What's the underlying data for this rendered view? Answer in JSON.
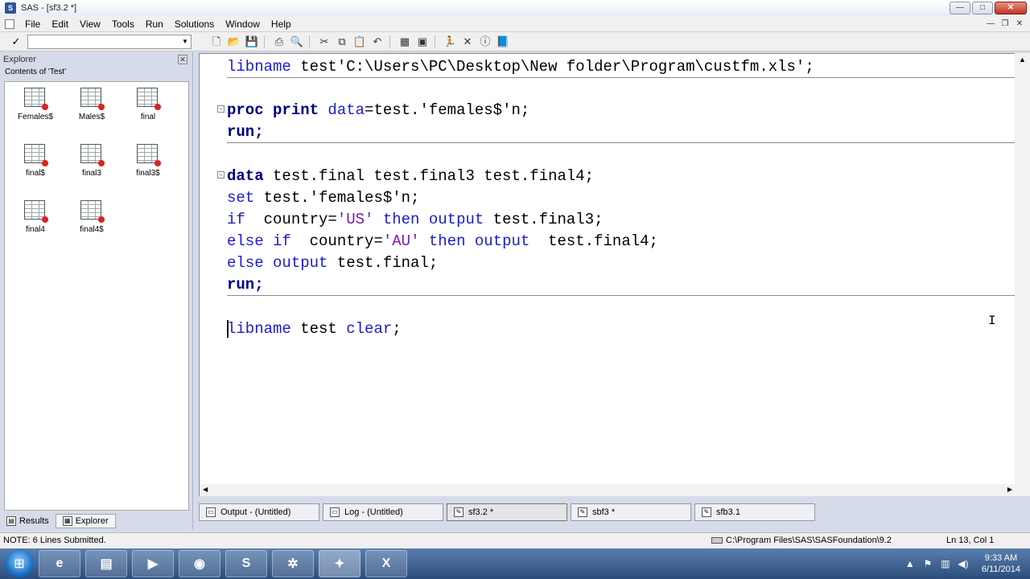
{
  "window": {
    "title": "SAS - [sf3.2 *]",
    "minimize": "—",
    "maximize": "□",
    "close": "✕"
  },
  "menu": [
    "File",
    "Edit",
    "View",
    "Tools",
    "Run",
    "Solutions",
    "Window",
    "Help"
  ],
  "toolbar": {
    "command_check": "✓",
    "command_value": ""
  },
  "explorer": {
    "title": "Explorer",
    "subtitle": "Contents of 'Test'",
    "items": [
      "Females$",
      "Males$",
      "final",
      "final$",
      "final3",
      "final3$",
      "final4",
      "final4$"
    ],
    "tabs": [
      "Results",
      "Explorer"
    ]
  },
  "editor": {
    "lines": {
      "l1a": "libname",
      "l1b": " test'C:\\Users\\PC\\Desktop\\New folder\\Program\\custfm.xls';",
      "l2a": "proc print",
      "l2b": " data",
      "l2c": "=test.'females$'n;",
      "l3": "run;",
      "l4a": "data",
      "l4b": " test.final test.final3 test.final4;",
      "l5a": "set",
      "l5b": " test.'females$'n;",
      "l6a": "if",
      "l6b": "  country=",
      "l6c": "'US'",
      "l6d": " then output",
      "l6e": " test.final3;",
      "l7a": "else if",
      "l7b": "  country=",
      "l7c": "'AU'",
      "l7d": " then output",
      "l7e": "  test.final4;",
      "l8a": "else output",
      "l8b": " test.final;",
      "l9": "run;",
      "l10a": "libname",
      "l10b": " test ",
      "l10c": "clear",
      "l10d": ";"
    }
  },
  "doc_tabs": [
    "Output - (Untitled)",
    "Log - (Untitled)",
    "sf3.2 *",
    "sbf3 *",
    "sfb3.1"
  ],
  "status": {
    "note": "NOTE: 6 Lines Submitted.",
    "path": "C:\\Program Files\\SAS\\SASFoundation\\9.2",
    "position": "Ln 13, Col 1"
  },
  "taskbar": {
    "clock_time": "9:33 AM",
    "clock_date": "6/11/2014"
  }
}
